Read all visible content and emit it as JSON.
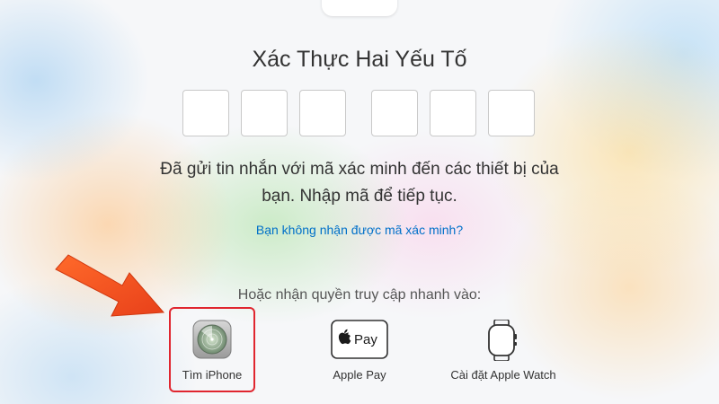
{
  "page": {
    "title": "Xác Thực Hai Yếu Tố",
    "code_digits": [
      "",
      "",
      "",
      "",
      "",
      ""
    ],
    "message_line1": "Đã gửi tin nhắn với mã xác minh đến các thiết bị của",
    "message_line2": "bạn. Nhập mã để tiếp tục.",
    "resend_link": "Bạn không nhận được mã xác minh?",
    "quick_access_label": "Hoặc nhận quyền truy cập nhanh vào:"
  },
  "quick_access": [
    {
      "label": "Tìm iPhone",
      "icon": "find-iphone-icon"
    },
    {
      "label": "Apple Pay",
      "icon": "apple-pay-icon"
    },
    {
      "label": "Cài đặt Apple Watch",
      "icon": "apple-watch-icon"
    }
  ],
  "colors": {
    "link": "#0070c9",
    "highlight": "#e0262f",
    "arrow": "#f04a1a",
    "text": "#333333"
  }
}
